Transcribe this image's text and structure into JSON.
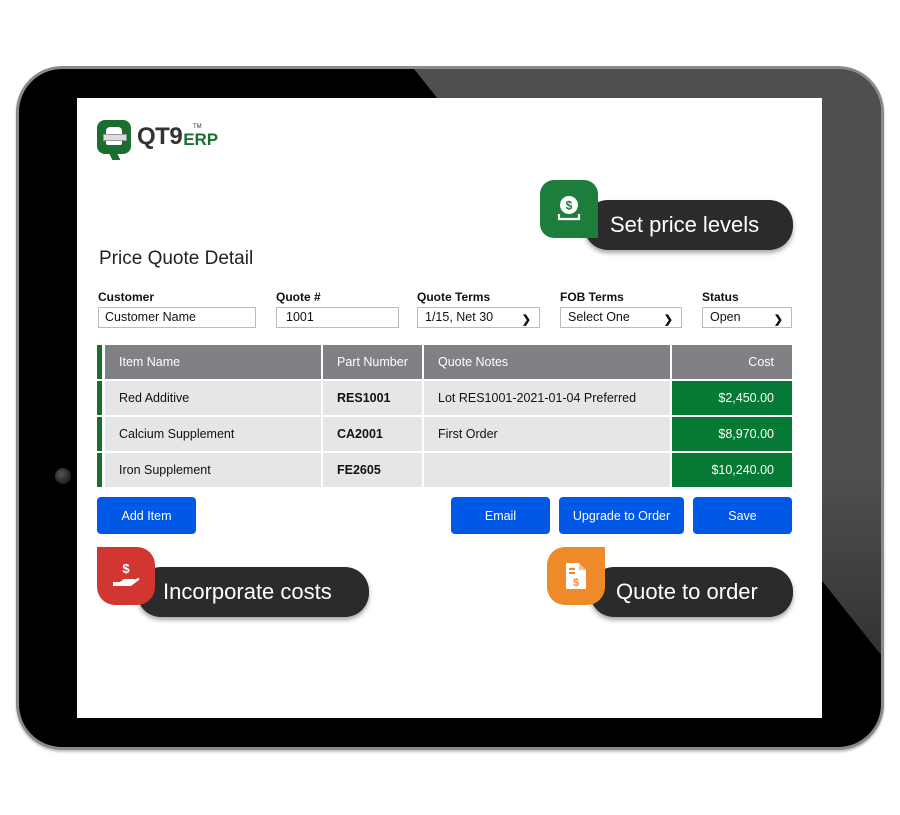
{
  "app": {
    "logo_text": "QT9",
    "logo_suffix": "ERP",
    "logo_tm": "TM"
  },
  "page_title": "Price Quote Detail",
  "fields": {
    "customer": {
      "label": "Customer",
      "value": "Customer Name"
    },
    "quote_number": {
      "label": "Quote #",
      "value": "1001"
    },
    "quote_terms": {
      "label": "Quote Terms",
      "value": "1/15, Net 30"
    },
    "fob_terms": {
      "label": "FOB Terms",
      "value": "Select One"
    },
    "status": {
      "label": "Status",
      "value": "Open"
    }
  },
  "table": {
    "columns": [
      "Item Name",
      "Part Number",
      "Quote Notes",
      "Cost"
    ],
    "rows": [
      {
        "item": "Red Additive",
        "part": "RES1001",
        "notes": "Lot RES1001-2021-01-04 Preferred",
        "cost": "$2,450.00"
      },
      {
        "item": "Calcium Supplement",
        "part": "CA2001",
        "notes": "First Order",
        "cost": "$8,970.00"
      },
      {
        "item": "Iron Supplement",
        "part": "FE2605",
        "notes": "",
        "cost": "$10,240.00"
      }
    ]
  },
  "buttons": {
    "add_item": "Add Item",
    "email": "Email",
    "upgrade": "Upgrade to Order",
    "save": "Save"
  },
  "callouts": {
    "price_levels": {
      "text": "Set price levels",
      "icon": "money-deposit-icon",
      "color": "#1d7e3c"
    },
    "costs": {
      "text": "Incorporate costs",
      "icon": "hand-dollar-icon",
      "color": "#d23631"
    },
    "quote_order": {
      "text": "Quote to order",
      "icon": "invoice-dollar-icon",
      "color": "#ef8a2a"
    }
  },
  "colors": {
    "brand_green": "#1a6e30",
    "cost_green": "#067a35",
    "button_blue": "#0058e6",
    "header_gray": "#808185"
  }
}
